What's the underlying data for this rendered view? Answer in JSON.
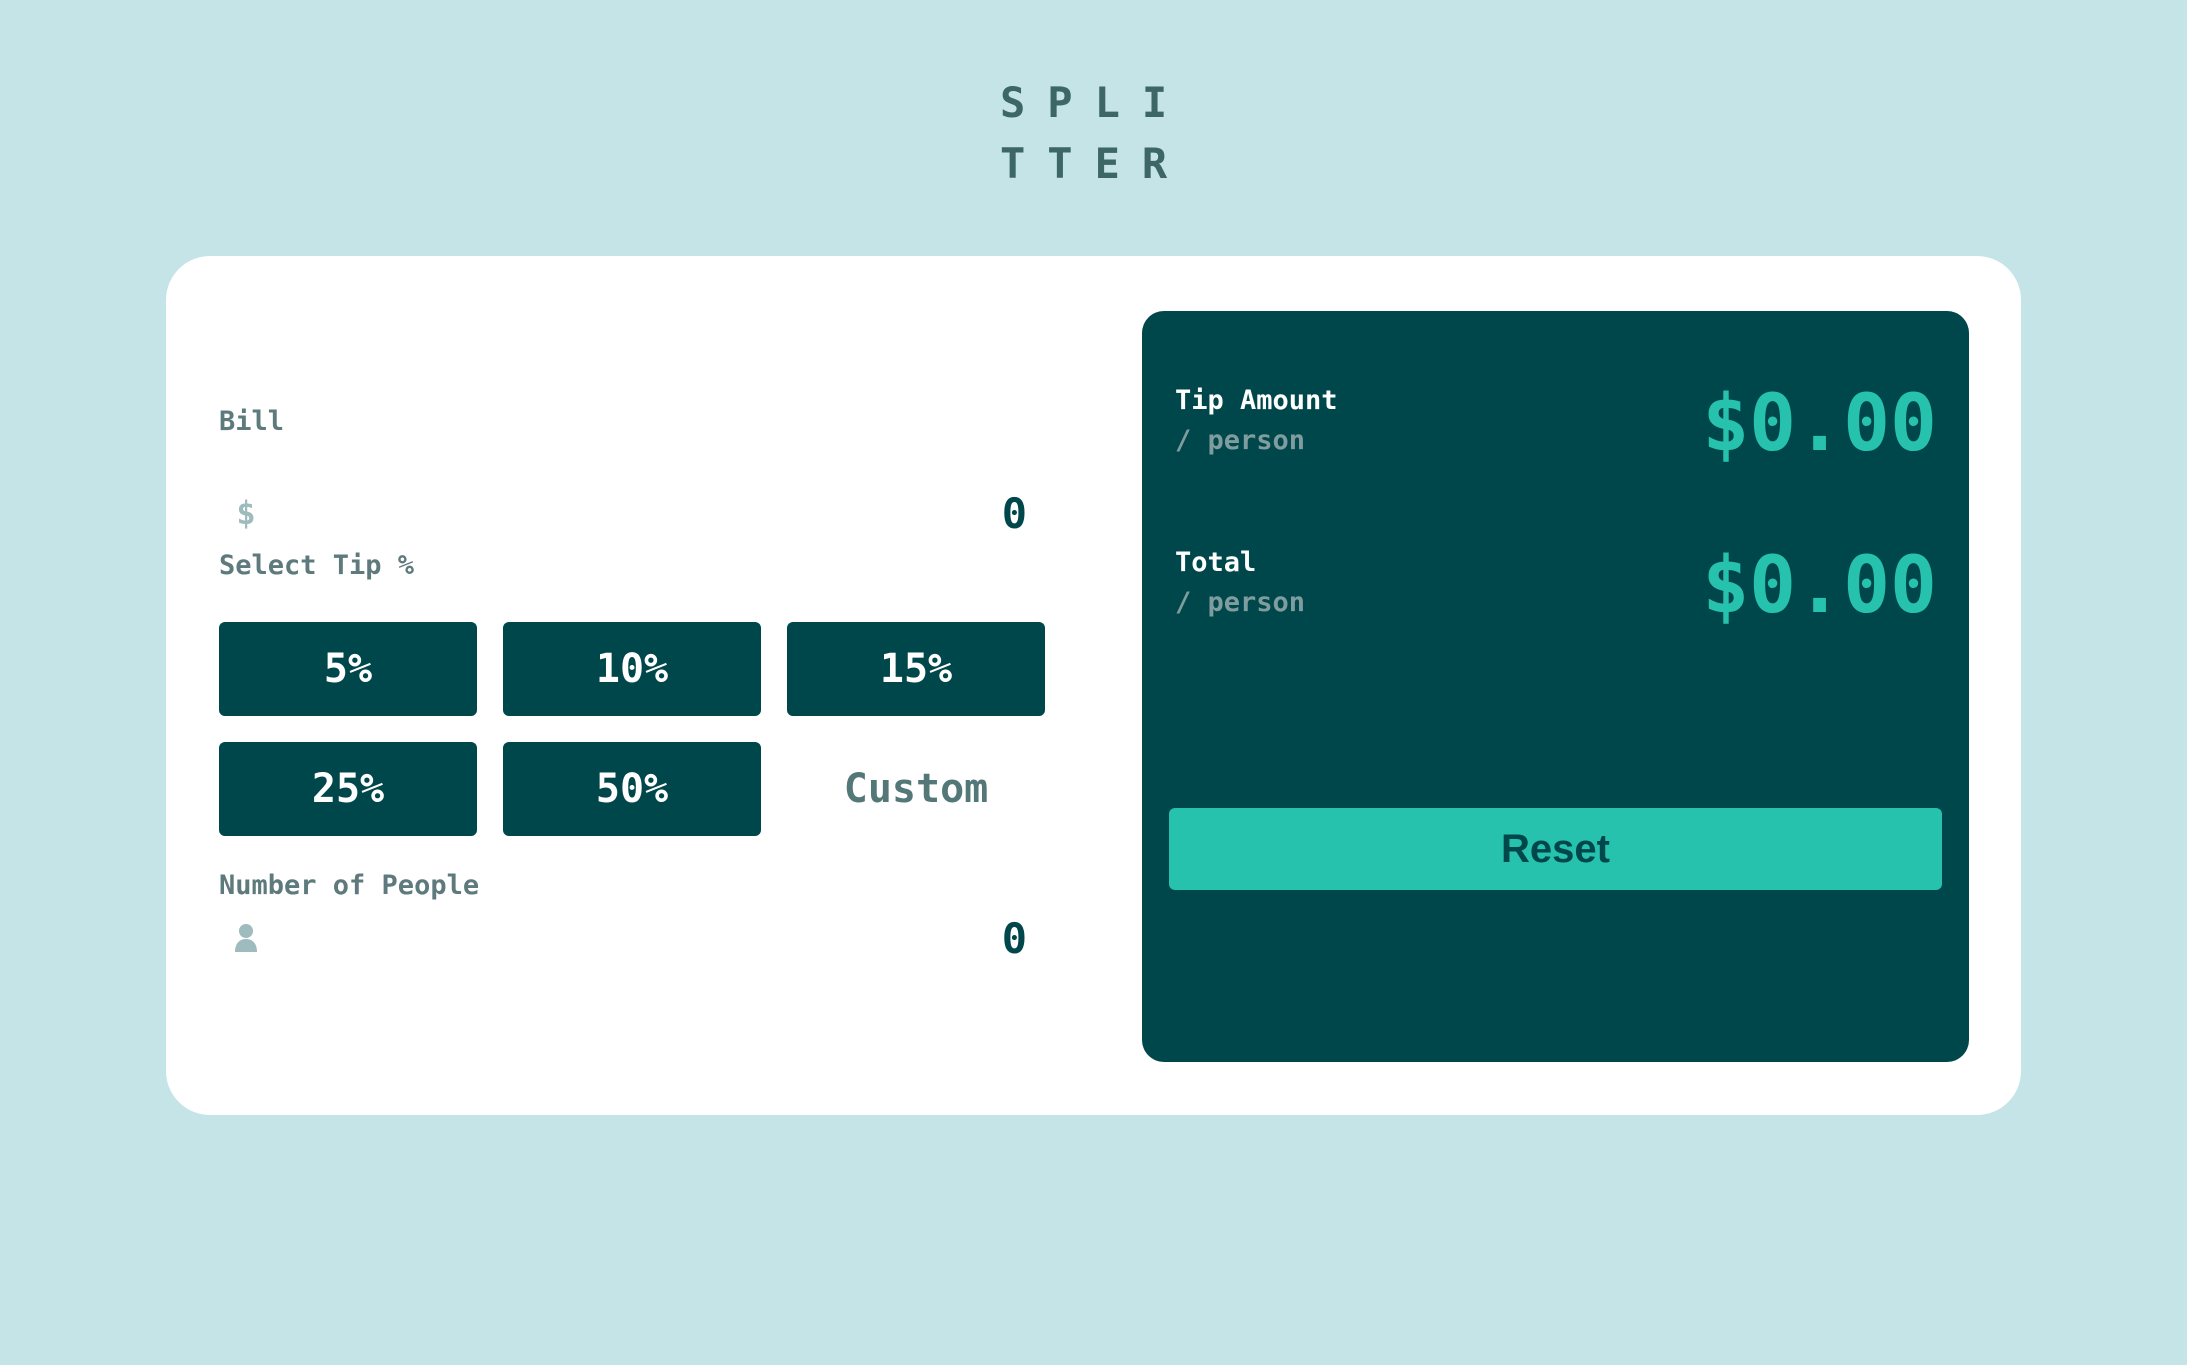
{
  "logo": {
    "line1": "SPLI",
    "line2": "TTER"
  },
  "form": {
    "bill_label": "Bill",
    "bill_icon": "$",
    "bill_value": "0",
    "tip_label": "Select Tip %",
    "tip_options": [
      "5%",
      "10%",
      "15%",
      "25%",
      "50%"
    ],
    "custom_label": "Custom",
    "people_label": "Number of People",
    "people_value": "0"
  },
  "results": {
    "tip_amount_label": "Tip Amount",
    "tip_amount_sub": "/ person",
    "tip_amount_value": "$0.00",
    "total_label": "Total",
    "total_sub": "/ person",
    "total_value": "$0.00",
    "reset_label": "Reset"
  },
  "colors": {
    "background": "#c5e4e7",
    "primary": "#00474b",
    "accent": "#26c2ad",
    "label": "#5e7a7d"
  }
}
